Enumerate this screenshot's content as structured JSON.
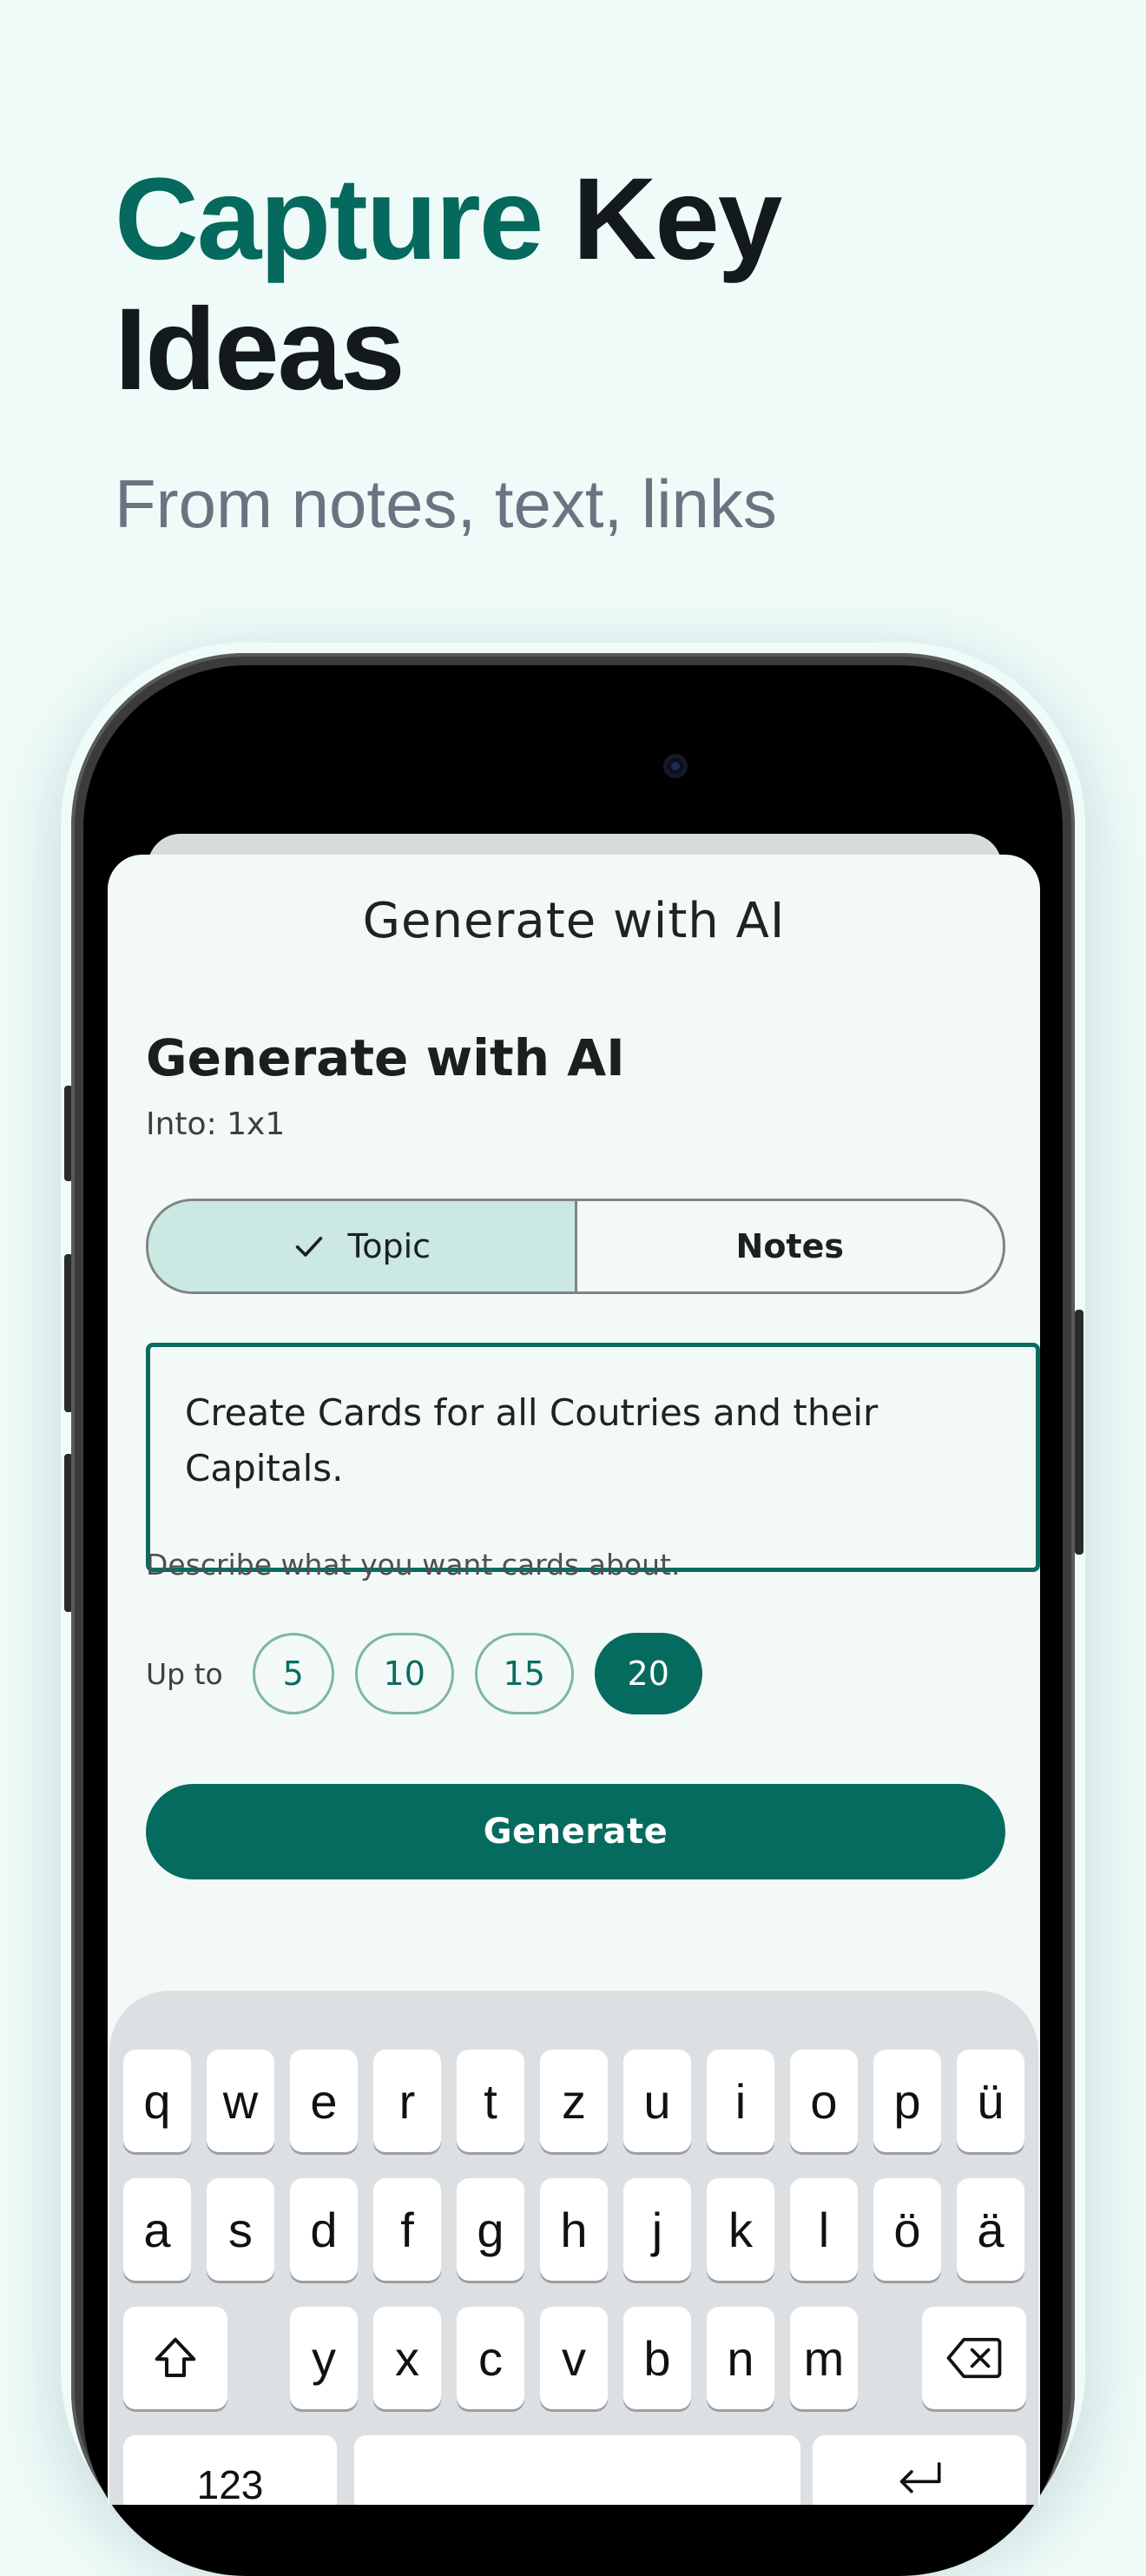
{
  "header": {
    "headline_accent": "Capture",
    "headline_rest": " Key Ideas",
    "subhead": "From notes, text, links"
  },
  "app": {
    "nav_title": "Generate with AI",
    "section_title": "Generate with AI",
    "into_label": "Into: 1x1",
    "tabs": [
      {
        "label": "Topic",
        "selected": true
      },
      {
        "label": "Notes",
        "selected": false
      }
    ],
    "prompt_value": "Create Cards for all Coutries and their Capitals.",
    "helper_text": "Describe what you want cards about.",
    "upto_label": "Up to",
    "count_options": [
      "5",
      "10",
      "15",
      "20"
    ],
    "count_selected": "20",
    "generate_label": "Generate"
  },
  "keyboard": {
    "row1": [
      "q",
      "w",
      "e",
      "r",
      "t",
      "z",
      "u",
      "i",
      "o",
      "p",
      "ü"
    ],
    "row2": [
      "a",
      "s",
      "d",
      "f",
      "g",
      "h",
      "j",
      "k",
      "l",
      "ö",
      "ä"
    ],
    "row3": [
      "y",
      "x",
      "c",
      "v",
      "b",
      "n",
      "m"
    ],
    "numbers_label": "123"
  },
  "colors": {
    "accent": "#05695d",
    "background": "#eefbf9",
    "selected_tab": "#cbe8e2"
  }
}
